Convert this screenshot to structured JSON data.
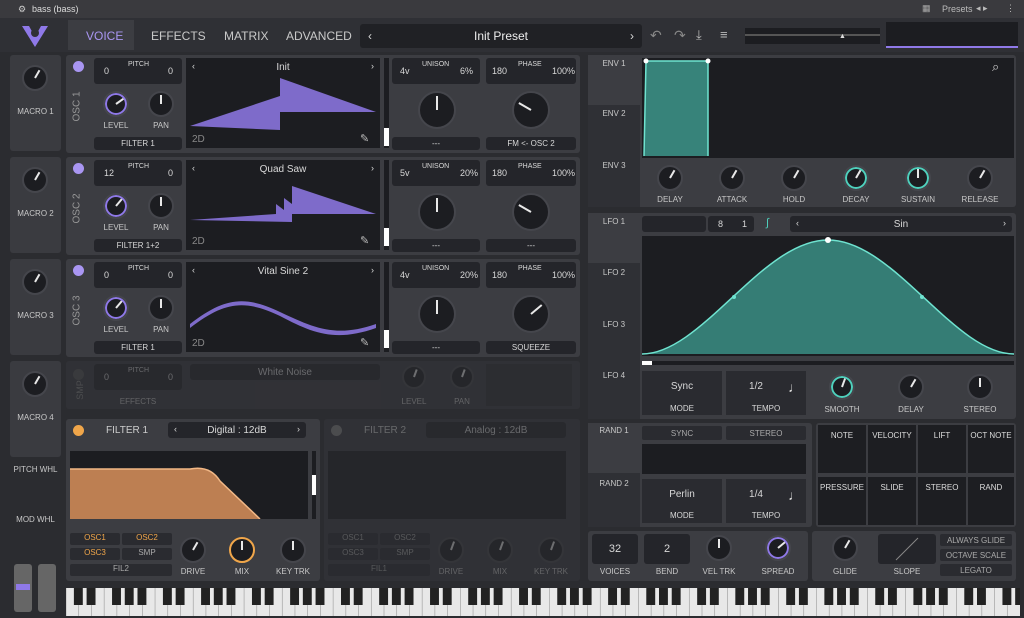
{
  "window": {
    "title": "bass (bass)",
    "presets_label": "Presets"
  },
  "nav": {
    "tabs": [
      "VOICE",
      "EFFECTS",
      "MATRIX",
      "ADVANCED"
    ],
    "active": "VOICE",
    "preset": "Init Preset"
  },
  "macros": [
    "MACRO 1",
    "MACRO 2",
    "MACRO 3",
    "MACRO 4"
  ],
  "wheels": {
    "pitch": "PITCH WHL",
    "mod": "MOD WHL"
  },
  "osc": [
    {
      "id": "OSC 1",
      "pitch_a": "0",
      "pitch_b": "0",
      "pitch_label": "PITCH",
      "level": "LEVEL",
      "pan": "PAN",
      "route": "FILTER 1",
      "wave": "Init",
      "dim": "2D",
      "unison_v": "4v",
      "unison_label": "UNISON",
      "unison_pct": "6%",
      "phase_a": "180",
      "phase_label": "PHASE",
      "phase_pct": "100%",
      "unison_sel": "---",
      "phase_sel": "FM <- OSC 2"
    },
    {
      "id": "OSC 2",
      "pitch_a": "12",
      "pitch_b": "0",
      "pitch_label": "PITCH",
      "level": "LEVEL",
      "pan": "PAN",
      "route": "FILTER 1+2",
      "wave": "Quad Saw",
      "dim": "2D",
      "unison_v": "5v",
      "unison_label": "UNISON",
      "unison_pct": "20%",
      "phase_a": "180",
      "phase_label": "PHASE",
      "phase_pct": "100%",
      "unison_sel": "---",
      "phase_sel": "---"
    },
    {
      "id": "OSC 3",
      "pitch_a": "0",
      "pitch_b": "0",
      "pitch_label": "PITCH",
      "level": "LEVEL",
      "pan": "PAN",
      "route": "FILTER 1",
      "wave": "Vital Sine 2",
      "dim": "2D",
      "unison_v": "4v",
      "unison_label": "UNISON",
      "unison_pct": "20%",
      "phase_a": "180",
      "phase_label": "PHASE",
      "phase_pct": "100%",
      "unison_sel": "---",
      "phase_sel": "SQUEEZE"
    }
  ],
  "smp": {
    "id": "SMP",
    "pitch_a": "0",
    "pitch_b": "0",
    "pitch_label": "PITCH",
    "route": "EFFECTS",
    "sample": "White Noise",
    "level": "LEVEL",
    "pan": "PAN"
  },
  "filter1": {
    "title": "FILTER 1",
    "type": "Digital : 12dB",
    "src": [
      "OSC1",
      "OSC2",
      "OSC3",
      "SMP"
    ],
    "fil2": "FIL2",
    "knobs": [
      "DRIVE",
      "MIX",
      "KEY TRK"
    ]
  },
  "filter2": {
    "title": "FILTER 2",
    "type": "Analog : 12dB",
    "src": [
      "OSC1",
      "OSC2",
      "OSC3",
      "SMP"
    ],
    "fil1": "FIL1",
    "knobs": [
      "DRIVE",
      "MIX",
      "KEY TRK"
    ]
  },
  "env": {
    "tabs": [
      "ENV 1",
      "ENV 2",
      "ENV 3"
    ],
    "knobs": [
      "DELAY",
      "ATTACK",
      "HOLD",
      "DECAY",
      "SUSTAIN",
      "RELEASE"
    ]
  },
  "lfo": {
    "tabs": [
      "LFO 1",
      "LFO 2",
      "LFO 3",
      "LFO 4"
    ],
    "num": "8",
    "den": "1",
    "shape": "Sin",
    "mode": "Sync",
    "mode_label": "MODE",
    "tempo": "1/2",
    "tempo_label": "TEMPO",
    "knobs": [
      "SMOOTH",
      "DELAY",
      "STEREO"
    ]
  },
  "rand": {
    "tabs": [
      "RAND 1",
      "RAND 2"
    ],
    "sync": "SYNC",
    "stereo": "STEREO",
    "mode": "Perlin",
    "mode_label": "MODE",
    "tempo": "1/4",
    "tempo_label": "TEMPO"
  },
  "mods": [
    "NOTE",
    "VELOCITY",
    "LIFT",
    "OCT NOTE",
    "PRESSURE",
    "SLIDE",
    "STEREO",
    "RAND"
  ],
  "voice": {
    "voices": "32",
    "voices_label": "VOICES",
    "bend": "2",
    "bend_label": "BEND",
    "vel": "VEL TRK",
    "spread": "SPREAD"
  },
  "glide": {
    "glide": "GLIDE",
    "slope": "SLOPE",
    "always": "ALWAYS GLIDE",
    "octave": "OCTAVE SCALE",
    "legato": "LEGATO"
  },
  "colors": {
    "accent": "#8f79e8",
    "teal": "#4fd1bd",
    "filter": "#f0a64a"
  }
}
